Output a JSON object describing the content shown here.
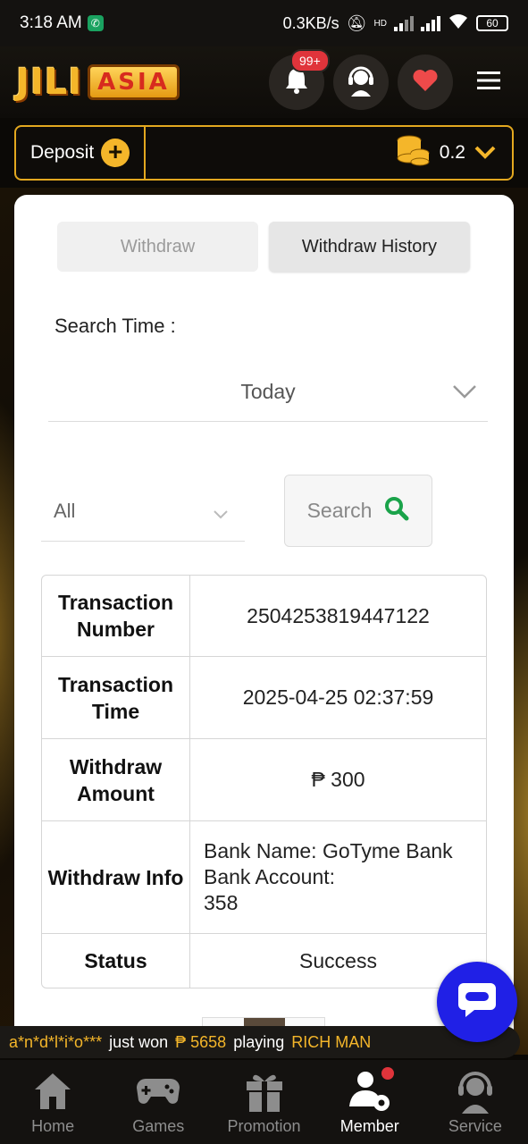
{
  "status_bar": {
    "time": "3:18 AM",
    "net_speed": "0.3KB/s",
    "battery": "60",
    "hd": "HD"
  },
  "header": {
    "logo_part1": "JILI",
    "logo_part2": "ASIA",
    "notification_count": "99+"
  },
  "deposit_bar": {
    "deposit_label": "Deposit",
    "balance": "0.2"
  },
  "tabs": [
    {
      "label": "Withdraw",
      "active": false
    },
    {
      "label": "Withdraw History",
      "active": true
    }
  ],
  "filters": {
    "search_time_label": "Search Time :",
    "time_value": "Today",
    "type_value": "All",
    "search_button": "Search"
  },
  "transaction": {
    "rows": [
      {
        "key": "Transaction Number",
        "value": "2504253819447122"
      },
      {
        "key": "Transaction Time",
        "value": "2025-04-25 02:37:59"
      },
      {
        "key": "Withdraw Amount",
        "value": "₱ 300"
      },
      {
        "key": "Withdraw Info",
        "value_lines": [
          "Bank Name: GoTyme Bank",
          "Bank Account:",
          "358"
        ]
      },
      {
        "key": "Status",
        "value": "Success"
      }
    ]
  },
  "ticker": {
    "user": "a*n*d*l*i*o***",
    "text1": "just won",
    "amount": "₱ 5658",
    "text2": "playing",
    "game": "RICH MAN"
  },
  "bottom_nav": [
    {
      "label": "Home",
      "icon": "home-icon"
    },
    {
      "label": "Games",
      "icon": "gamepad-icon"
    },
    {
      "label": "Promotion",
      "icon": "gift-icon"
    },
    {
      "label": "Member",
      "icon": "member-icon",
      "active": true
    },
    {
      "label": "Service",
      "icon": "headset-icon"
    }
  ],
  "colors": {
    "gold": "#f4b62a",
    "chat_blue": "#2020e6",
    "badge_red": "#e0343b",
    "search_green": "#1aa34a"
  }
}
